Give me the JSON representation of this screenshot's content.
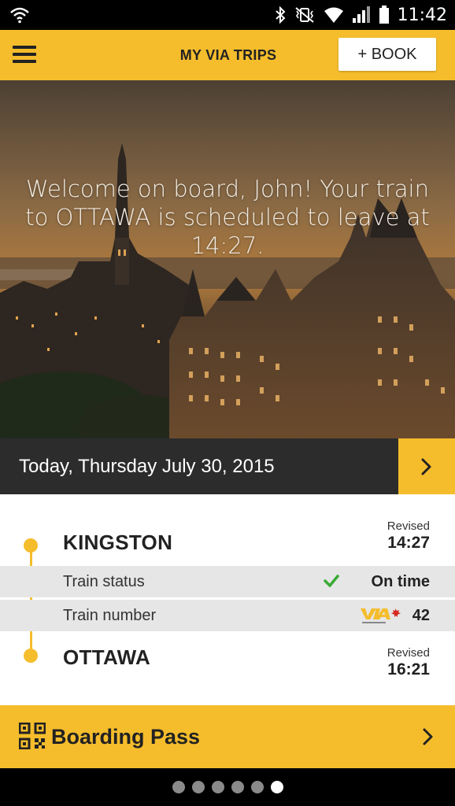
{
  "status_bar": {
    "time": "11:42",
    "icons": [
      "wifi-question-icon",
      "bluetooth-icon",
      "vibrate-mute-icon",
      "wifi-icon",
      "signal-icon",
      "battery-icon"
    ]
  },
  "app_bar": {
    "menu_icon": "hamburger-menu-icon",
    "title": "MY VIA TRIPS",
    "book_label": "+ BOOK"
  },
  "hero": {
    "message": "Welcome on board, John! Your train to OTTAWA is scheduled to leave at 14:27."
  },
  "date_bar": {
    "date": "Today, Thursday July 30, 2015",
    "next_icon": "chevron-right-icon"
  },
  "trip": {
    "departure": {
      "station": "KINGSTON",
      "revised_label": "Revised",
      "time": "14:27"
    },
    "arrival": {
      "station": "OTTAWA",
      "revised_label": "Revised",
      "time": "16:21"
    },
    "status": {
      "label": "Train status",
      "value": "On time",
      "icon": "checkmark-icon"
    },
    "number": {
      "label": "Train number",
      "value": "42",
      "logo": "via-rail-logo"
    }
  },
  "boarding_pass": {
    "label": "Boarding Pass",
    "icon": "qr-code-icon"
  },
  "pager": {
    "total": 6,
    "active_index": 5
  },
  "colors": {
    "accent": "#f5bd2c",
    "dark": "#2c2c2c",
    "row_bg": "#e6e6e6",
    "check": "#3aaa35"
  }
}
